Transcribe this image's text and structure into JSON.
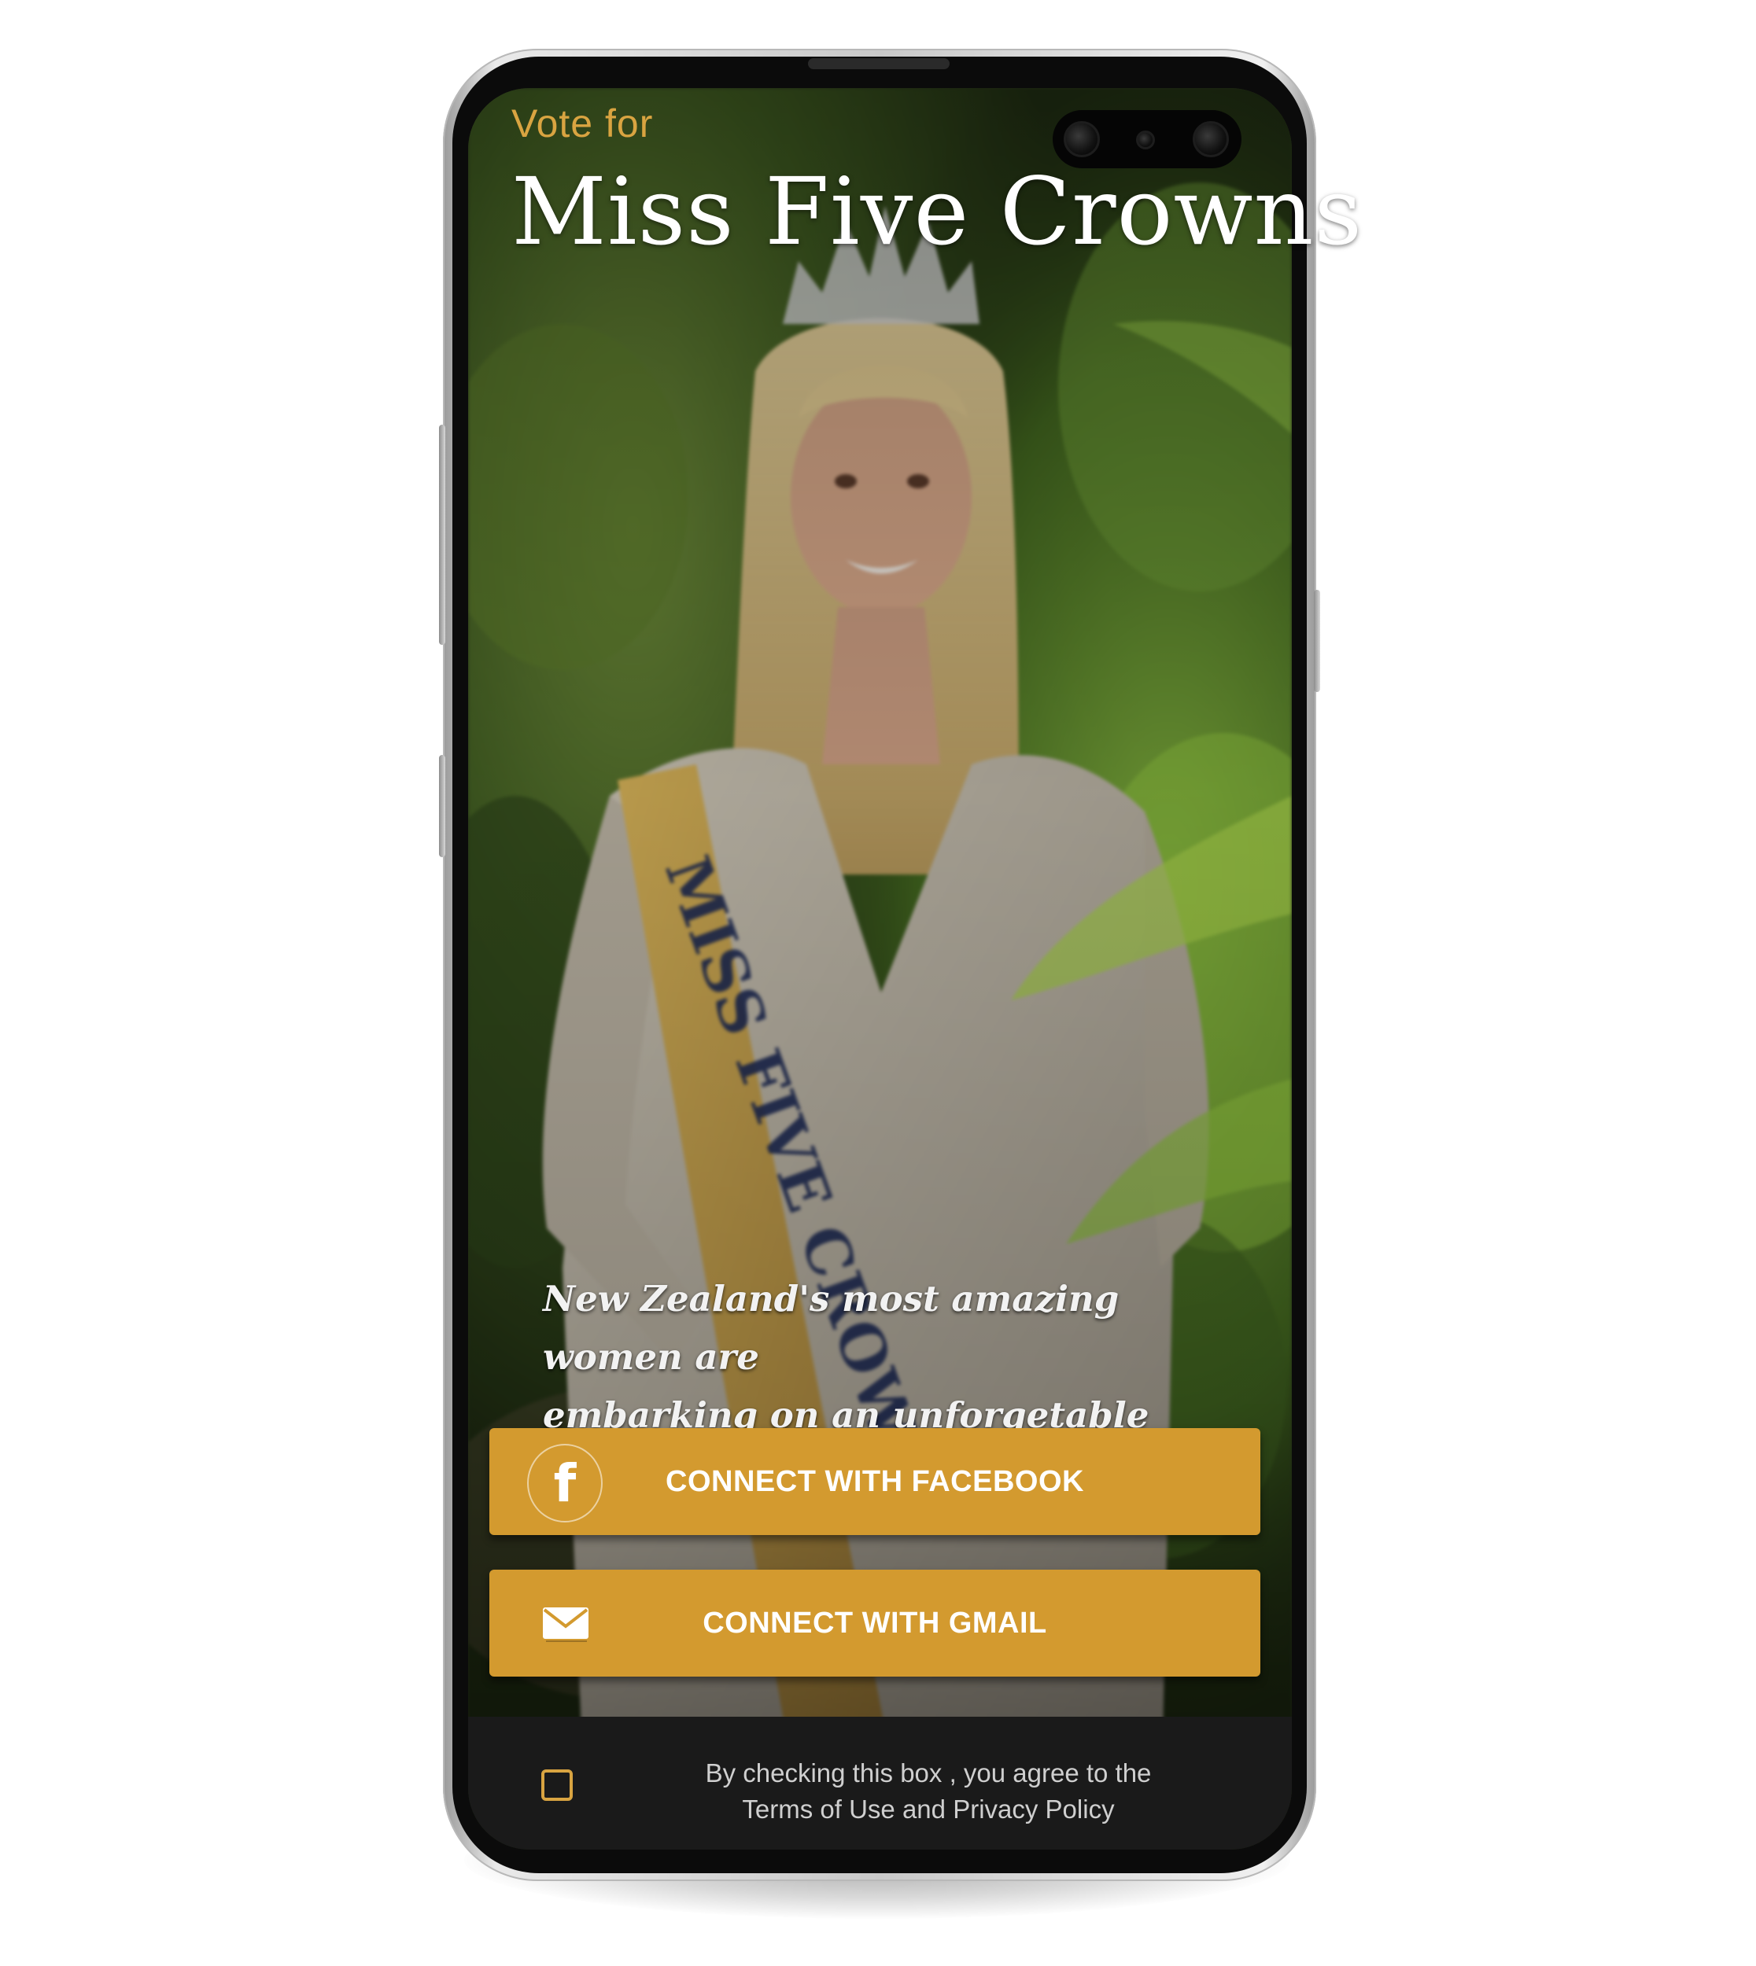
{
  "header": {
    "kicker": "Vote for",
    "title": "Miss Five Crowns"
  },
  "hero": {
    "tagline_line1": "New Zealand's most amazing women are",
    "tagline_line2": "embarking on  an unforgetable journey"
  },
  "actions": {
    "facebook_label": "CONNECT WITH FACEBOOK",
    "gmail_label": "CONNECT WITH GMAIL"
  },
  "consent": {
    "text": "By checking this box , you agree to the",
    "terms_link": "Terms of Use",
    "joiner": " and ",
    "privacy_link": "Privacy Policy",
    "checked": false
  },
  "icons": {
    "facebook": "facebook-icon",
    "gmail": "mail-envelope-icon",
    "checkbox": "checkbox-icon"
  },
  "colors": {
    "accent": "#d39a2f",
    "kicker": "#d9a441",
    "bottom_bar": "#1a1a1a"
  }
}
